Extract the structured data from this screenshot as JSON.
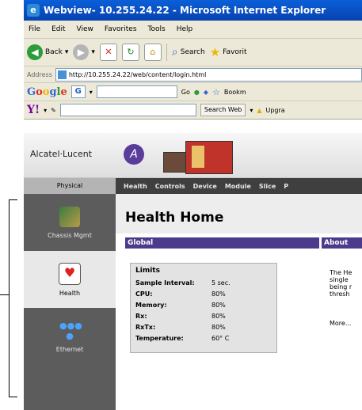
{
  "window": {
    "title": "Webview- 10.255.24.22 - Microsoft Internet Explorer"
  },
  "menu": [
    "File",
    "Edit",
    "View",
    "Favorites",
    "Tools",
    "Help"
  ],
  "toolbar": {
    "back": "Back",
    "search": "Search",
    "favorites": "Favorit"
  },
  "address": {
    "label": "Address",
    "url": "http://10.255.24.22/web/content/login.html"
  },
  "google": {
    "logo": "Google",
    "combo": "G",
    "go": "Go",
    "bookmarks": "Bookm"
  },
  "yahoo": {
    "logo": "Y!",
    "search_button": "Search Web",
    "upgrade": "Upgra"
  },
  "brand": {
    "name": "Alcatel·Lucent"
  },
  "nav": {
    "physical": "Physical",
    "tabs": [
      "Health",
      "Controls",
      "Device",
      "Module",
      "Slice",
      "P"
    ]
  },
  "sidebar": [
    {
      "label": "Chassis Mgmt",
      "icon": "chassis-icon"
    },
    {
      "label": "Health",
      "icon": "health-icon"
    },
    {
      "label": "Ethernet",
      "icon": "ethernet-icon"
    }
  ],
  "main": {
    "title": "Health Home",
    "global_header": "Global",
    "about_header": "About",
    "limits": {
      "title": "Limits",
      "rows": [
        {
          "key": "Sample Interval:",
          "value": "5 sec."
        },
        {
          "key": "CPU:",
          "value": "80%"
        },
        {
          "key": "Memory:",
          "value": "80%"
        },
        {
          "key": "Rx:",
          "value": "80%"
        },
        {
          "key": "RxTx:",
          "value": "80%"
        },
        {
          "key": "Temperature:",
          "value": "60° C"
        }
      ]
    },
    "about_text": "The He\nsingle\nbeing r\nthresh",
    "about_more": "More..."
  }
}
